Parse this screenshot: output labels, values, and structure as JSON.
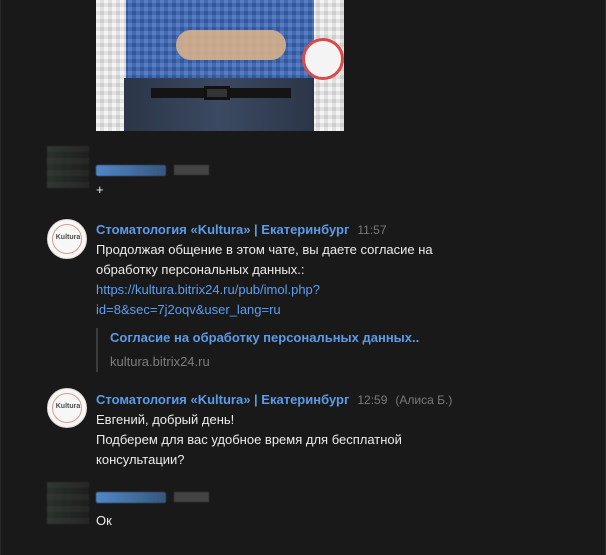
{
  "messages": [
    {
      "sender": "Евгений",
      "time": "11:57",
      "text": "+"
    },
    {
      "sender": "Стоматология «Kultura» | Екатеринбург",
      "time": "11:57",
      "text_line_1": "Продолжая общение в этом чате, вы даете согласие на",
      "text_line_2": "обработку персональных данных.:",
      "link_line_1": "https://kultura.bitrix24.ru/pub/imol.php?",
      "link_line_2": "id=8&sec=7j2oqv&user_lang=ru",
      "preview": {
        "title": "Согласие на обработку персональных данных..",
        "domain": "kultura.bitrix24.ru"
      },
      "avatar_label": "Kultura"
    },
    {
      "sender": "Стоматология «Kultura» | Екатеринбург",
      "time": "12:59",
      "operator": "(Алиса Б.)",
      "text_line_1": "Евгений, добрый день!",
      "text_line_2": "Подберем для вас удобное время для бесплатной",
      "text_line_3": "консультации?",
      "avatar_label": "Kultura"
    },
    {
      "text": "Ок"
    }
  ],
  "colors": {
    "background": "#191919",
    "accent": "#5b9be8",
    "link": "#5d9ef0",
    "muted": "#7a7a7a"
  }
}
